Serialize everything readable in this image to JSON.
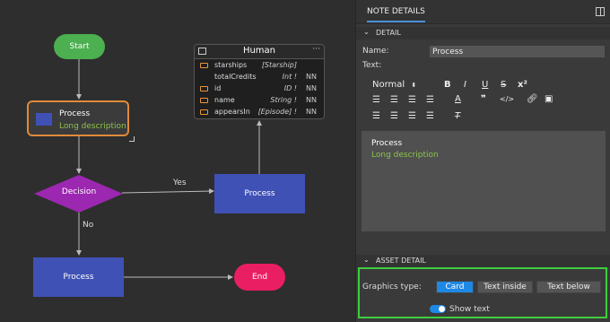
{
  "diagram": {
    "start": "Start",
    "process_selected": {
      "title": "Process",
      "description": "Long description"
    },
    "decision": "Decision",
    "yes_label": "Yes",
    "no_label": "No",
    "process_right": "Process",
    "process_bottom": "Process",
    "end": "End"
  },
  "class_card": {
    "title": "Human",
    "rows": [
      {
        "name": "starships",
        "type": "[Starship]",
        "nn": ""
      },
      {
        "name": "totalCredits",
        "type": "Int !",
        "nn": "NN"
      },
      {
        "name": "id",
        "type": "ID !",
        "nn": "NN"
      },
      {
        "name": "name",
        "type": "String !",
        "nn": "NN"
      },
      {
        "name": "appearsIn",
        "type": "[Episode] !",
        "nn": "NN"
      }
    ]
  },
  "panel": {
    "tab": "NOTE DETAILS",
    "detail_section": "DETAIL",
    "name_label": "Name:",
    "name_value": "Process",
    "text_label": "Text:",
    "toolbar": {
      "format_select": "Normal",
      "bold": "B",
      "italic": "I",
      "underline": "U",
      "strike": "S",
      "superscript": "x²",
      "quote": "❞",
      "code": "</>"
    },
    "editor": {
      "line1": "Process",
      "line2": "Long description"
    },
    "asset_section": "ASSET DETAIL",
    "graphics_label": "Graphics type:",
    "graphics_options": [
      "Card",
      "Text inside",
      "Text below"
    ],
    "graphics_selected": "Card",
    "show_text_label": "Show text",
    "show_text_on": true
  }
}
